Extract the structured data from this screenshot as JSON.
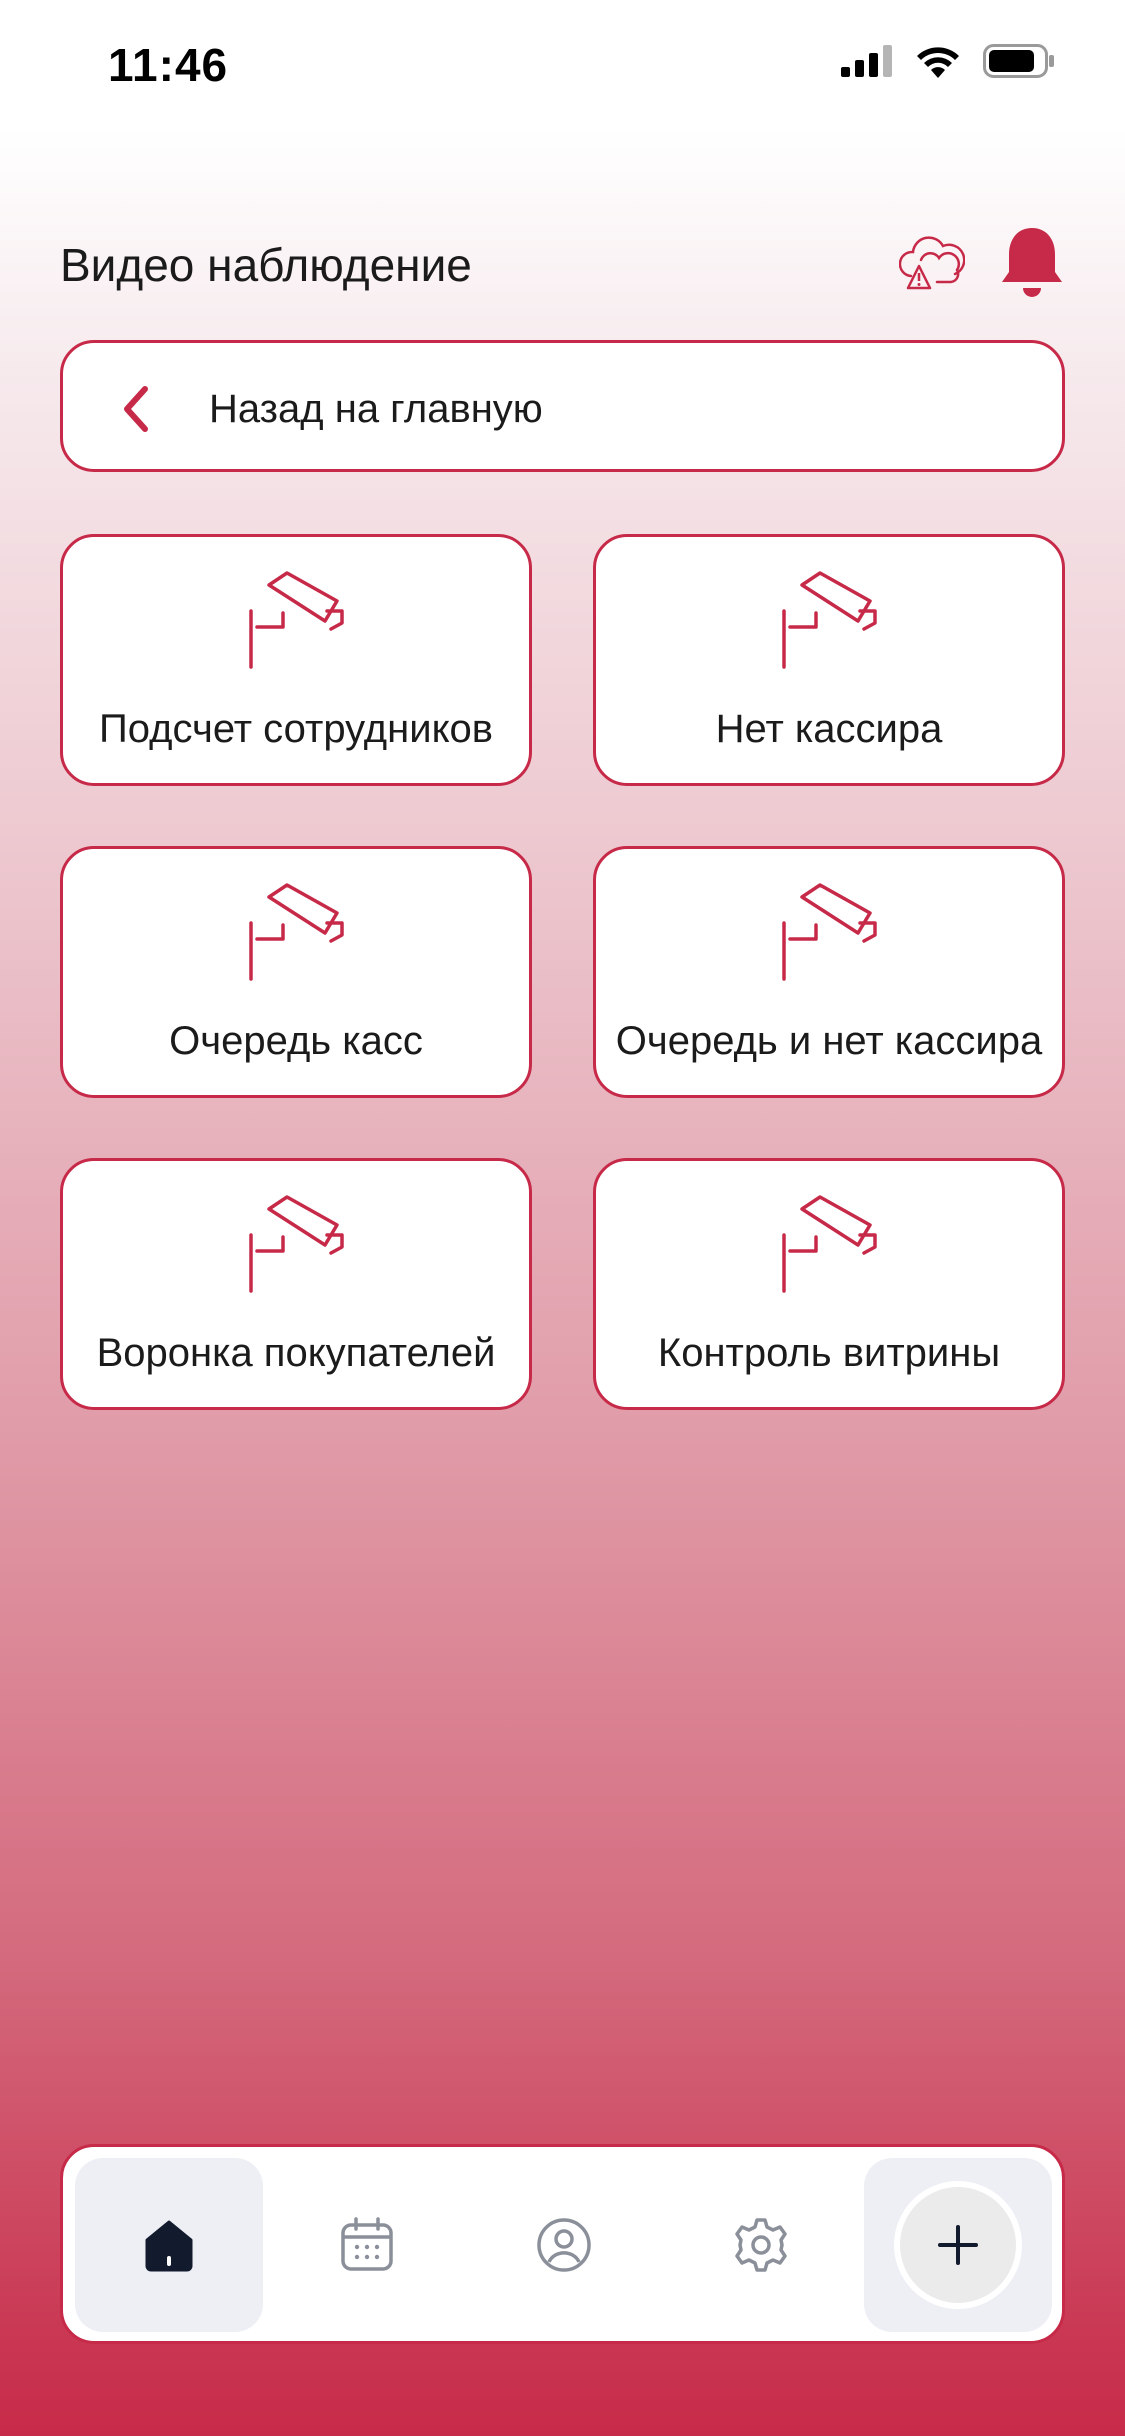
{
  "status_bar": {
    "time": "11:46"
  },
  "header": {
    "title": "Видео наблюдение",
    "icons": [
      "cloud-warning-icon",
      "bell-icon"
    ]
  },
  "back_button": {
    "label": "Назад на главную"
  },
  "cards": [
    {
      "label": "Подсчет сотрудников",
      "icon": "security-camera-icon"
    },
    {
      "label": "Нет кассира",
      "icon": "security-camera-icon"
    },
    {
      "label": "Очередь касс",
      "icon": "security-camera-icon"
    },
    {
      "label": "Очередь и нет кассира",
      "icon": "security-camera-icon"
    },
    {
      "label": "Воронка покупателей",
      "icon": "security-camera-icon"
    },
    {
      "label": "Контроль витрины",
      "icon": "security-camera-icon"
    }
  ],
  "tab_bar": {
    "items": [
      "home-icon",
      "calendar-icon",
      "profile-icon",
      "settings-icon",
      "plus-icon"
    ],
    "active": "home-icon"
  },
  "colors": {
    "accent": "#c72a48",
    "text": "#1b1b1b",
    "tab_active_bg": "#edeff5"
  }
}
